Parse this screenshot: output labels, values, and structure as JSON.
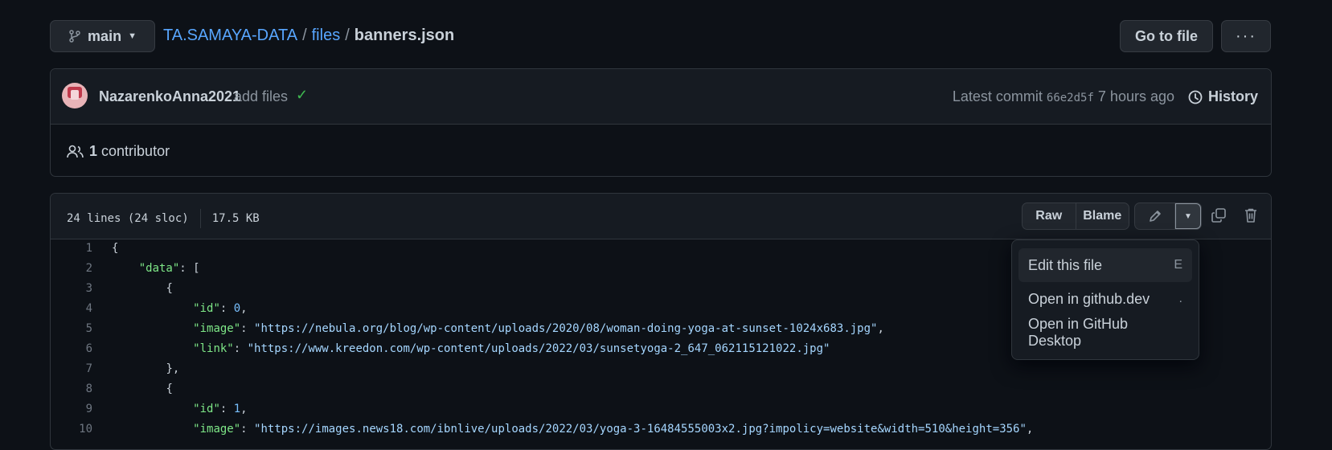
{
  "branch": {
    "name": "main"
  },
  "breadcrumb": {
    "repo": "TA.SAMAYA-DATA",
    "separator": "/",
    "folder": "files",
    "file": "banners.json"
  },
  "header_buttons": {
    "go_to_file": "Go to file",
    "more": "···"
  },
  "commit": {
    "author": "NazarenkoAnna2021",
    "message": "add files",
    "latest_label": "Latest commit",
    "sha": "66e2d5f",
    "time": "7 hours ago",
    "history_label": "History"
  },
  "contributors": {
    "count": "1",
    "label": "contributor"
  },
  "file_header": {
    "lines": "24 lines (24 sloc)",
    "size": "17.5 KB",
    "raw": "Raw",
    "blame": "Blame"
  },
  "dropdown": {
    "items": [
      {
        "label": "Edit this file",
        "shortcut": "E"
      },
      {
        "label": "Open in github.dev",
        "shortcut": "."
      },
      {
        "label": "Open in GitHub Desktop",
        "shortcut": ""
      }
    ]
  },
  "code_lines": [
    {
      "num": "1",
      "indent": "",
      "parts": [
        [
          "pun",
          "{"
        ]
      ]
    },
    {
      "num": "2",
      "indent": "    ",
      "parts": [
        [
          "key",
          "\"data\""
        ],
        [
          "pun",
          ": ["
        ]
      ]
    },
    {
      "num": "3",
      "indent": "        ",
      "parts": [
        [
          "pun",
          "{"
        ]
      ]
    },
    {
      "num": "4",
      "indent": "            ",
      "parts": [
        [
          "key",
          "\"id\""
        ],
        [
          "pun",
          ": "
        ],
        [
          "num",
          "0"
        ],
        [
          "pun",
          ","
        ]
      ]
    },
    {
      "num": "5",
      "indent": "            ",
      "parts": [
        [
          "key",
          "\"image\""
        ],
        [
          "pun",
          ": "
        ],
        [
          "str",
          "\"https://nebula.org/blog/wp-content/uploads/2020/08/woman-doing-yoga-at-sunset-1024x683.jpg\""
        ],
        [
          "pun",
          ","
        ]
      ]
    },
    {
      "num": "6",
      "indent": "            ",
      "parts": [
        [
          "key",
          "\"link\""
        ],
        [
          "pun",
          ": "
        ],
        [
          "str",
          "\"https://www.kreedon.com/wp-content/uploads/2022/03/sunsetyoga-2_647_062115121022.jpg\""
        ]
      ]
    },
    {
      "num": "7",
      "indent": "        ",
      "parts": [
        [
          "pun",
          "},"
        ]
      ]
    },
    {
      "num": "8",
      "indent": "        ",
      "parts": [
        [
          "pun",
          "{"
        ]
      ]
    },
    {
      "num": "9",
      "indent": "            ",
      "parts": [
        [
          "key",
          "\"id\""
        ],
        [
          "pun",
          ": "
        ],
        [
          "num",
          "1"
        ],
        [
          "pun",
          ","
        ]
      ]
    },
    {
      "num": "10",
      "indent": "            ",
      "parts": [
        [
          "key",
          "\"image\""
        ],
        [
          "pun",
          ": "
        ],
        [
          "str",
          "\"https://images.news18.com/ibnlive/uploads/2022/03/yoga-3-16484555003x2.jpg?impolicy=website&width=510&height=356\""
        ],
        [
          "pun",
          ","
        ]
      ]
    }
  ]
}
